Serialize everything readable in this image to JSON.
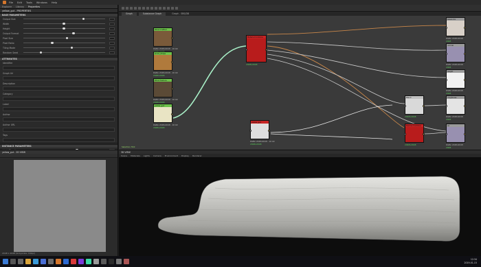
{
  "menubar": {
    "items": [
      "File",
      "Edit",
      "Tools",
      "Windows",
      "Help"
    ]
  },
  "properties": {
    "tabs": [
      "Explorer",
      "Library",
      "Properties"
    ],
    "panel_title": "yellow_gut - PROPERTIES",
    "sections": [
      {
        "title": "BASE PARAMETERS",
        "rows": [
          {
            "label": "Output Size",
            "pos": 0.72
          },
          {
            "label": "Width",
            "pos": 0.48
          },
          {
            "label": "Height",
            "pos": 0.48
          },
          {
            "label": "Output Format",
            "pos": 0.6
          },
          {
            "label": "Pixel Size",
            "pos": 0.52
          },
          {
            "label": "Pixel Ratio",
            "pos": 0.34
          },
          {
            "label": "Tiling Mode",
            "pos": 0.58
          },
          {
            "label": "Random Seed",
            "pos": 0.2
          }
        ]
      },
      {
        "title": "ATTRIBUTES",
        "rows": [
          {
            "label": "Identifier",
            "pos": 0.0
          },
          {
            "label": "Graph Url",
            "pos": 0.0
          },
          {
            "label": "Description",
            "pos": 0.0
          },
          {
            "label": "Category",
            "pos": 0.0
          },
          {
            "label": "Label",
            "pos": 0.0
          },
          {
            "label": "Author",
            "pos": 0.0
          },
          {
            "label": "Author URL",
            "pos": 0.0
          },
          {
            "label": "Tags",
            "pos": 0.0
          }
        ]
      },
      {
        "title": "INSTANCE PARAMETERS",
        "rows": [
          {
            "label": "Light Direction",
            "pos": 0.64
          },
          {
            "label": "Contrast",
            "pos": 0.56
          },
          {
            "label": "Intensity",
            "pos": 0.44
          },
          {
            "label": "Balance",
            "pos": 0.28
          }
        ]
      }
    ]
  },
  "graph": {
    "title": "Graph - SBS/DB",
    "tabs": [
      "Graph",
      "Substance Graph"
    ],
    "selection_label": "Selection",
    "nodes": [
      {
        "header": "Wood Crafted",
        "label": "Bitmap - Wood",
        "size": "2048x2048",
        "info": "RGBA 2048x2048 - 16 bit",
        "bg": "#7a5a3a",
        "hc": "#6cc24a"
      },
      {
        "header": "wood_shape",
        "label": "Bitmap",
        "size": "2048x2048",
        "info": "RGBA 2048x2048 - 16 bit",
        "bg": "#b07a3c",
        "hc": "#6cc24a"
      },
      {
        "header": "Wood Texture",
        "label": "Bitmap",
        "size": "2048x2048",
        "info": "RGBA 2048x2048 - 16 bit",
        "bg": "#5b4a36",
        "hc": "#6cc24a"
      },
      {
        "header": "yellow_gut",
        "label": "Bitmap",
        "size": "2048x2048",
        "info": "RGBA 2048x2048 - 16 bit",
        "bg": "#e9e4c4",
        "hc": "#6cc24a"
      },
      {
        "header": "Material Combine",
        "label": "Blend",
        "size": "2048x2048",
        "info": "",
        "bg": "#b81c1c",
        "hc": "#c62424"
      },
      {
        "header": "yellow_gut",
        "label": "Grayscale",
        "size": "2048x2048",
        "info": "RGBA 2048x2048 - 16 bit",
        "bg": "#dedede",
        "hc": "#c62424"
      },
      {
        "header": "Blend",
        "label": "Blend",
        "size": "2048x2048",
        "info": "",
        "bg": "#d9d9d9",
        "hc": "#c0c0c0"
      },
      {
        "header": "Normal Combine",
        "label": "Normal",
        "size": "2048x2048",
        "info": "",
        "bg": "#b81c1c",
        "hc": "#c62424"
      },
      {
        "header": "basecolor",
        "label": "Output",
        "size": "2048",
        "info": "RGBA 2048x2048",
        "bg": "#d8d0c8",
        "hc": "#9a9a9a"
      },
      {
        "header": "normal",
        "label": "Output",
        "size": "2048",
        "info": "RGBA 2048x2048",
        "bg": "#9890b0",
        "hc": "#9a9a9a"
      },
      {
        "header": "height",
        "label": "Output",
        "size": "2048",
        "info": "RGBA 2048x2048",
        "bg": "#f2f2f2",
        "hc": "#9a9a9a"
      },
      {
        "header": "roughness",
        "label": "Output",
        "size": "2048",
        "info": "RGBA 2048x2048",
        "bg": "#e4e4e4",
        "hc": "#9a9a9a"
      },
      {
        "header": "ao",
        "label": "Output",
        "size": "2048",
        "info": "RGBA 2048x2048",
        "bg": "#9890b0",
        "hc": "#9a9a9a"
      }
    ],
    "bottom_label": "Selection Hint"
  },
  "view2d": {
    "title": "yellow_gut - 2D VIEW",
    "status": "2048 x 2048 (Grayscale, 16bpc)"
  },
  "view3d": {
    "title": "3D VIEW",
    "menu": [
      "Scene",
      "Materials",
      "Lights",
      "Camera",
      "Environment",
      "Display",
      "Renderer"
    ]
  },
  "taskbar": {
    "time": "12:34",
    "date": "2019-01-15",
    "icons": [
      "start-icon",
      "search-icon",
      "task-view-icon",
      "folder-icon",
      "browser-icon",
      "mail-icon",
      "store-icon",
      "substance-icon",
      "photoshop-icon",
      "chrome-icon",
      "media-icon",
      "notes-icon",
      "calc-icon",
      "settings-icon",
      "terminal-icon",
      "file-icon",
      "app-icon"
    ]
  }
}
